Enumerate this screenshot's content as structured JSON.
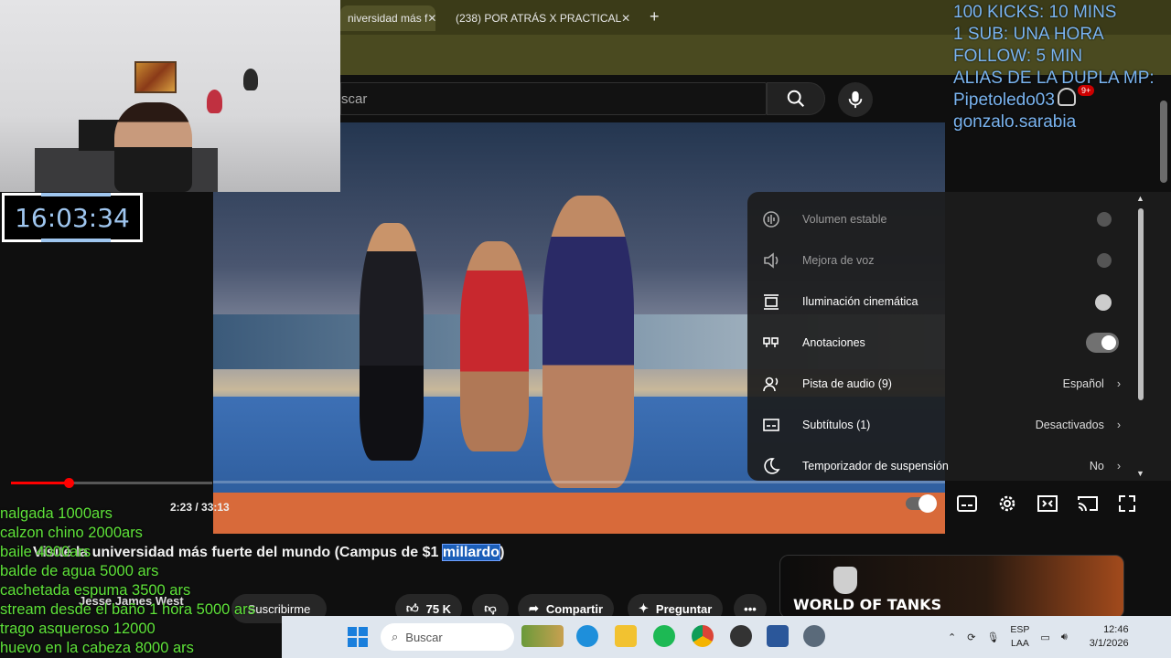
{
  "browser": {
    "tabs": [
      {
        "title": "niversidad más f",
        "icon": "youtube-icon"
      },
      {
        "title": "(238) POR ATRÁS X PRACTICAL",
        "icon": "youtube-icon"
      }
    ],
    "new_tab_label": "+"
  },
  "youtube": {
    "search_placeholder": "scar",
    "notification_count": "9+",
    "video_title_part1": "Visité la universidad más fuerte del mundo (Campus de $1 ",
    "video_title_highlight": "millardo",
    "video_title_part2": ")",
    "channel_name": "Jesse James West",
    "subscribe_label": "Suscribirme",
    "like_count": "75 K",
    "share_label": "Compartir",
    "ask_label": "Preguntar",
    "more_label": "•••",
    "time_display": "2:23 / 33:13",
    "progress_fraction": 0.072,
    "ad_brand": "WORLD OF TANKS"
  },
  "settings_menu": {
    "items": [
      {
        "label": "Volumen estable",
        "icon": "stable-volume-icon",
        "control": "toggle",
        "state": "disabled"
      },
      {
        "label": "Mejora de voz",
        "icon": "voice-boost-icon",
        "control": "toggle",
        "state": "disabled"
      },
      {
        "label": "Iluminación cinemática",
        "icon": "ambient-mode-icon",
        "control": "toggle",
        "state": "off"
      },
      {
        "label": "Anotaciones",
        "icon": "annotations-icon",
        "control": "toggle",
        "state": "on"
      },
      {
        "label": "Pista de audio (9)",
        "icon": "audio-track-icon",
        "control": "value",
        "value": "Español"
      },
      {
        "label": "Subtítulos (1)",
        "icon": "subtitles-icon",
        "control": "value",
        "value": "Desactivados"
      },
      {
        "label": "Temporizador de suspensión",
        "icon": "sleep-timer-icon",
        "control": "value",
        "value": "No"
      }
    ]
  },
  "stream_overlay": {
    "clock": "16:03:34",
    "rules": [
      "100 KICKS: 10 MINS",
      "1 SUB: UNA HORA",
      "FOLLOW: 5 MIN",
      "ALIAS DE LA DUPLA MP:",
      "Pipetoledo03",
      "gonzalo.sarabia"
    ],
    "prices": [
      "nalgada 1000ars",
      "calzon chino 2000ars",
      "baile 4000ars",
      "balde de agua 5000 ars",
      "cachetada espuma 3500 ars",
      "stream desde el baño 1 hora 5000 ars",
      "trago asqueroso 12000",
      "huevo en la cabeza 8000 ars"
    ]
  },
  "taskbar": {
    "search_label": "Buscar",
    "language": "ESP",
    "layout": "LAA",
    "time": "12:46",
    "date": "3/1/2026"
  },
  "colors": {
    "overlay_blue": "#7ab4f0",
    "overlay_green": "#5fe33a",
    "youtube_red": "#ff0000",
    "highlight": "#1b5eb8"
  }
}
